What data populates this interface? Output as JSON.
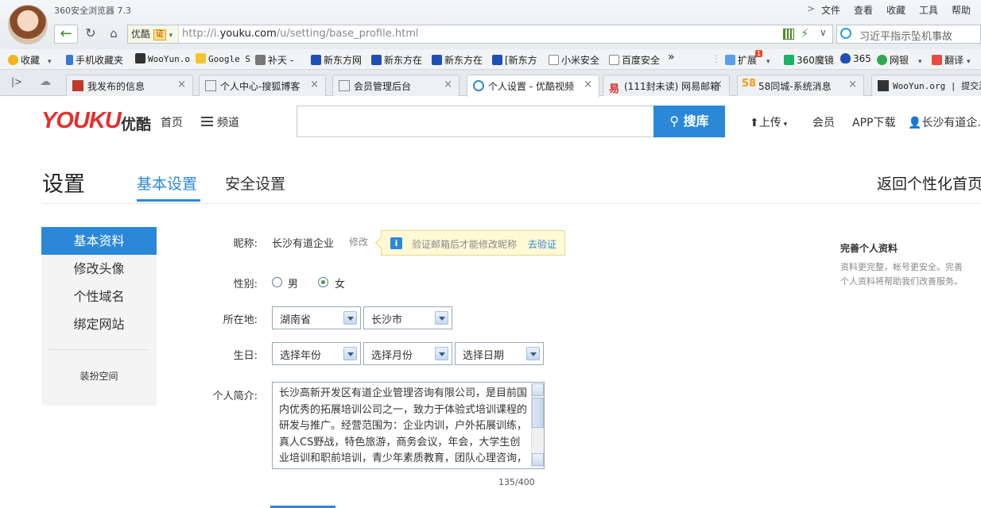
{
  "browser": {
    "title": "360安全浏览器 7.3",
    "menu": [
      "文件",
      "查看",
      "收藏",
      "工具",
      "帮助"
    ],
    "site_badge": "优酷",
    "cert_label": "证",
    "url_prefix": "http://i.",
    "url_domain": "youku.com",
    "url_path": "/u/setting/base_profile.html",
    "search_text": "习近平指示坠机事故",
    "bookmarks": [
      "收藏",
      "手机收藏夹",
      "WooYun.o",
      "Google S",
      "补天 -",
      "新东方网",
      "新东方在",
      "新东方在",
      "[新东方",
      "小米安全",
      "百度安全",
      "»",
      "扩展",
      "360魔镜",
      "365",
      "网银",
      "翻译"
    ],
    "ext_badge": "1",
    "tabs": [
      {
        "label": "我发布的信息"
      },
      {
        "label": "个人中心-搜狐博客"
      },
      {
        "label": "会员管理后台"
      },
      {
        "label": "个人设置 - 优酷视频"
      },
      {
        "label": "(111封未读) 网易邮箱"
      },
      {
        "label": "58同城-系统消息"
      },
      {
        "label": "WooYun.org | 提交漏洞"
      }
    ],
    "tab_58_badge": "58"
  },
  "header": {
    "logo": "YOUKU",
    "logo_cn": "优酷",
    "home": "首页",
    "channel": "频道",
    "search_button": "搜库",
    "upload": "上传",
    "member": "会员",
    "app": "APP下载",
    "user": "长沙有道企..."
  },
  "settings": {
    "title": "设置",
    "tab_basic": "基本设置",
    "tab_security": "安全设置",
    "back_home": "返回个性化首页"
  },
  "sidebar": {
    "items": [
      {
        "label": "基本资料"
      },
      {
        "label": "修改头像"
      },
      {
        "label": "个性域名"
      },
      {
        "label": "绑定网站"
      }
    ],
    "extra": "装扮空间"
  },
  "form": {
    "nickname_label": "昵称:",
    "nickname_value": "长沙有道企业",
    "nickname_edit": "修改",
    "verify_tip": "验证邮箱后才能修改昵称",
    "verify_link": "去验证",
    "gender_label": "性别:",
    "gender_male": "男",
    "gender_female": "女",
    "gender_selected": "女",
    "location_label": "所在地:",
    "province": "湖南省",
    "city": "长沙市",
    "birthday_label": "生日:",
    "year": "选择年份",
    "month": "选择月份",
    "day": "选择日期",
    "bio_label": "个人简介:",
    "bio_text": "长沙高新开发区有道企业管理咨询有限公司，是目前国内优秀的拓展培训公司之一，致力于体验式培训课程的研发与推广。经营范围为：企业内训，户外拓展训练，真人CS野战，特色旅游，商务会议，年会，大学生创业培训和职前培训，青少年素质教育，团队心理咨询，高尔夫球，户外活动策划执行等",
    "bio_count": "135/400"
  },
  "profile_tip": {
    "title": "完善个人资料",
    "text": "资料更完整，帐号更安全。完善个人资料将帮助我们改善服务。"
  },
  "colors": {
    "brand_red": "#e62e2e",
    "accent_blue": "#2b88d8"
  }
}
